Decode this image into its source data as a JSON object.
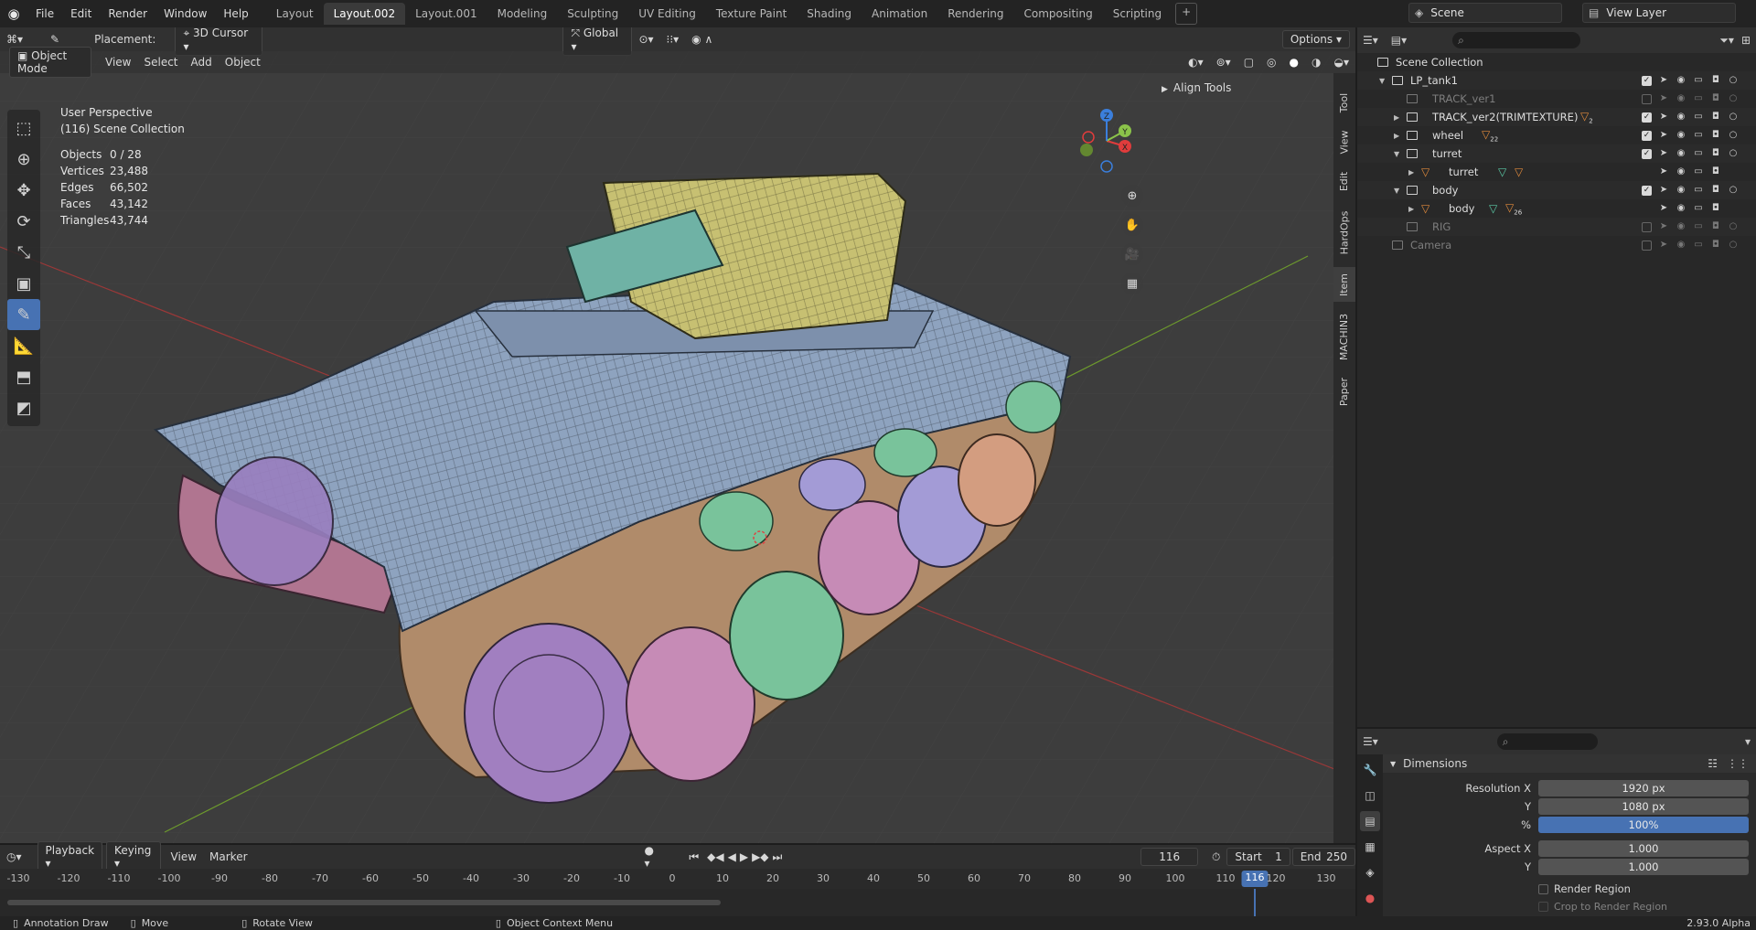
{
  "topbar": {
    "menus": [
      "File",
      "Edit",
      "Render",
      "Window",
      "Help"
    ],
    "workspaces": [
      "Layout",
      "Layout.002",
      "Layout.001",
      "Modeling",
      "Sculpting",
      "UV Editing",
      "Texture Paint",
      "Shading",
      "Animation",
      "Rendering",
      "Compositing",
      "Scripting"
    ],
    "active_workspace": "Layout.002",
    "add_tab": "+",
    "scene": "Scene",
    "view_layer": "View Layer"
  },
  "viewport": {
    "placement_label": "Placement:",
    "placement_value": "3D Cursor",
    "transform_orientation": "Global",
    "options": "Options",
    "mode": "Object Mode",
    "header_menus": [
      "View",
      "Select",
      "Add",
      "Object"
    ],
    "perspective": "User Perspective",
    "collection_info": "(116) Scene Collection",
    "stats": [
      {
        "label": "Objects",
        "value": "0 / 28"
      },
      {
        "label": "Vertices",
        "value": "23,488"
      },
      {
        "label": "Edges",
        "value": "66,502"
      },
      {
        "label": "Faces",
        "value": "43,142"
      },
      {
        "label": "Triangles",
        "value": "43,744"
      }
    ],
    "n_panel_section": "Align Tools",
    "side_tabs": [
      "Tool",
      "View",
      "Edit",
      "HardOps",
      "Item",
      "MACHIN3",
      "Paper"
    ],
    "active_side_tab": "Item",
    "gizmo": {
      "x": "X",
      "y": "Y",
      "z": "Z"
    }
  },
  "outliner": {
    "rows": [
      {
        "name": "Scene Collection",
        "indent": 0,
        "type": "scene",
        "dim": false
      },
      {
        "name": "LP_tank1",
        "indent": 1,
        "type": "collection",
        "expanded": true,
        "checked": true
      },
      {
        "name": "TRACK_ver1",
        "indent": 2,
        "type": "collection",
        "dim": true,
        "checked": false
      },
      {
        "name": "TRACK_ver2(TRIMTEXTURE)",
        "indent": 2,
        "type": "collection",
        "collapsed": true,
        "checked": true,
        "badge": "2"
      },
      {
        "name": "wheel",
        "indent": 2,
        "type": "collection",
        "collapsed": true,
        "checked": true,
        "badge": "22"
      },
      {
        "name": "turret",
        "indent": 2,
        "type": "collection",
        "expanded": true,
        "checked": true
      },
      {
        "name": "turret",
        "indent": 3,
        "type": "mesh",
        "collapsed": true
      },
      {
        "name": "body",
        "indent": 2,
        "type": "collection",
        "expanded": true,
        "checked": true
      },
      {
        "name": "body",
        "indent": 3,
        "type": "mesh",
        "collapsed": true,
        "badge": "26"
      },
      {
        "name": "RIG",
        "indent": 2,
        "type": "collection",
        "dim": true,
        "checked": false
      },
      {
        "name": "Camera",
        "indent": 1,
        "type": "collection",
        "dim": true,
        "checked": false
      }
    ]
  },
  "properties": {
    "section": "Dimensions",
    "fields": [
      {
        "label": "Resolution X",
        "value": "1920 px"
      },
      {
        "label": "Y",
        "value": "1080 px"
      },
      {
        "label": "%",
        "value": "100%",
        "highlight": true
      },
      {
        "label": "Aspect X",
        "value": "1.000"
      },
      {
        "label": "Y",
        "value": "1.000"
      }
    ],
    "render_region": "Render Region",
    "crop": "Crop to Render Region"
  },
  "timeline": {
    "menus": [
      "Playback",
      "Keying",
      "View",
      "Marker"
    ],
    "current_frame": "116",
    "start_label": "Start",
    "start": "1",
    "end_label": "End",
    "end": "250",
    "ticks": [
      "-130",
      "-120",
      "-110",
      "-100",
      "-90",
      "-80",
      "-70",
      "-60",
      "-50",
      "-40",
      "-30",
      "-20",
      "-10",
      "0",
      "10",
      "20",
      "30",
      "40",
      "50",
      "60",
      "70",
      "80",
      "90",
      "100",
      "110",
      "116",
      "120",
      "130"
    ]
  },
  "statusbar": {
    "items": [
      "Annotation Draw",
      "Move",
      "Rotate View",
      "Object Context Menu"
    ],
    "version": "2.93.0 Alpha"
  },
  "colors": {
    "accent": "#4772b3",
    "axis_x": "#e03c3c",
    "axis_y": "#8bc34a",
    "axis_z": "#3b7fdc"
  }
}
